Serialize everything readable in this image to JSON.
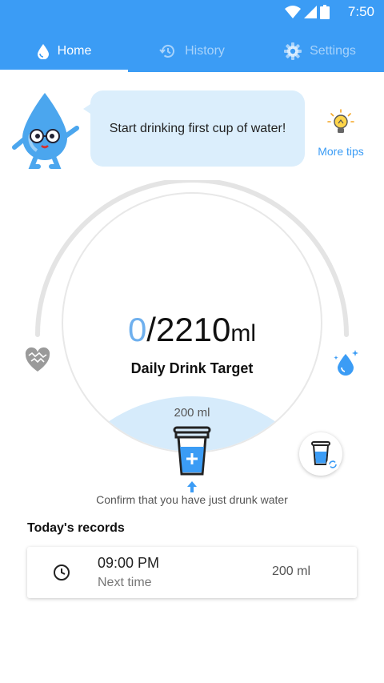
{
  "status_bar": {
    "time": "7:50"
  },
  "tabs": [
    {
      "label": "Home",
      "icon": "water-drop-icon",
      "active": true
    },
    {
      "label": "History",
      "icon": "history-icon",
      "active": false
    },
    {
      "label": "Settings",
      "icon": "gear-icon",
      "active": false
    }
  ],
  "tip": {
    "message": "Start drinking first cup of water!",
    "more_tips": "More tips"
  },
  "progress": {
    "current": "0",
    "separator": "/",
    "target": "2210",
    "unit": "ml",
    "label": "Daily Drink Target"
  },
  "cup": {
    "amount": "200 ml",
    "confirm_text": "Confirm that you have just drunk water"
  },
  "records": {
    "title": "Today's records",
    "items": [
      {
        "time": "09:00 PM",
        "note": "Next time",
        "amount": "200 ml"
      }
    ]
  },
  "colors": {
    "accent": "#3b9cf5",
    "light_blue": "#dbeefc",
    "progress_text": "#6fb0ee"
  }
}
